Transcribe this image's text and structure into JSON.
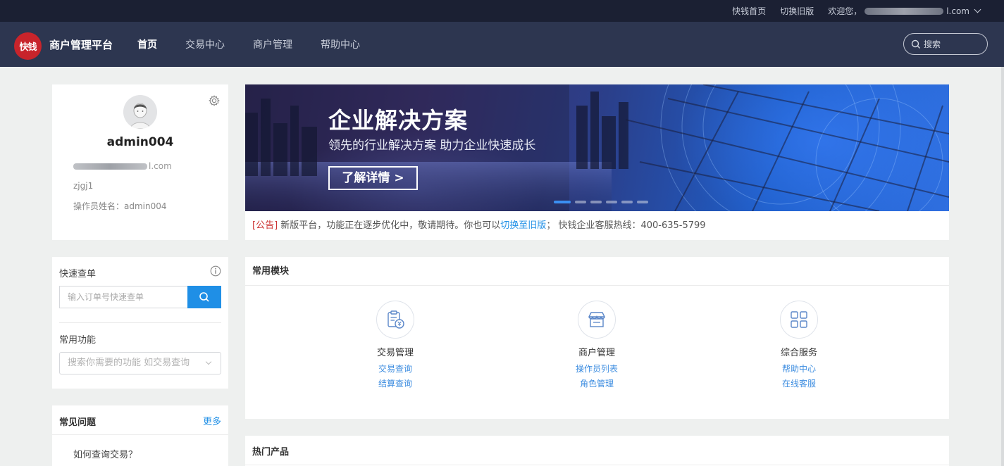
{
  "topbar": {
    "home_link": "快钱首页",
    "switch_link": "切换旧版",
    "welcome": "欢迎您，",
    "email_tail": "l.com"
  },
  "nav": {
    "logo_text": "快钱",
    "brand": "商户管理平台",
    "items": [
      "首页",
      "交易中心",
      "商户管理",
      "帮助中心"
    ],
    "active_index": 0,
    "search_placeholder": "搜索"
  },
  "profile": {
    "username": "admin004",
    "email_tail": "l.com",
    "account": "zjgj1",
    "operator": "操作员姓名：admin004"
  },
  "quick_query": {
    "title": "快速查单",
    "input_placeholder": "输入订单号快速查单",
    "common_title": "常用功能",
    "function_placeholder": "搜索你需要的功能 如交易查询"
  },
  "faq": {
    "title": "常见问题",
    "more": "更多",
    "items": [
      "如何查询交易？"
    ]
  },
  "banner": {
    "title": "企业解决方案",
    "subtitle": "领先的行业解决方案 助力企业快速成长",
    "button": "了解详情 >",
    "slide_count": 6,
    "active_slide": 0
  },
  "notice": {
    "tag": "[公告]",
    "text1": " 新版平台，功能正在逐步优化中，敬请期待。你也可以",
    "link": "切换至旧版",
    "text2": "； 快钱企业客服热线：400-635-5799"
  },
  "modules": {
    "title": "常用模块",
    "items": [
      {
        "title": "交易管理",
        "icon": "clipboard-yuan-icon",
        "links": [
          "交易查询",
          "结算查询"
        ]
      },
      {
        "title": "商户管理",
        "icon": "store-icon",
        "links": [
          "操作员列表",
          "角色管理"
        ]
      },
      {
        "title": "综合服务",
        "icon": "grid-icon",
        "links": [
          "帮助中心",
          "在线客服"
        ]
      }
    ]
  },
  "hot": {
    "title": "热门产品"
  },
  "colors": {
    "accent": "#1f8fe6",
    "nav_bg": "#2d3650",
    "top_bg": "#1b2033",
    "logo_red": "#c8242b",
    "notice_tag": "#cc3333"
  }
}
